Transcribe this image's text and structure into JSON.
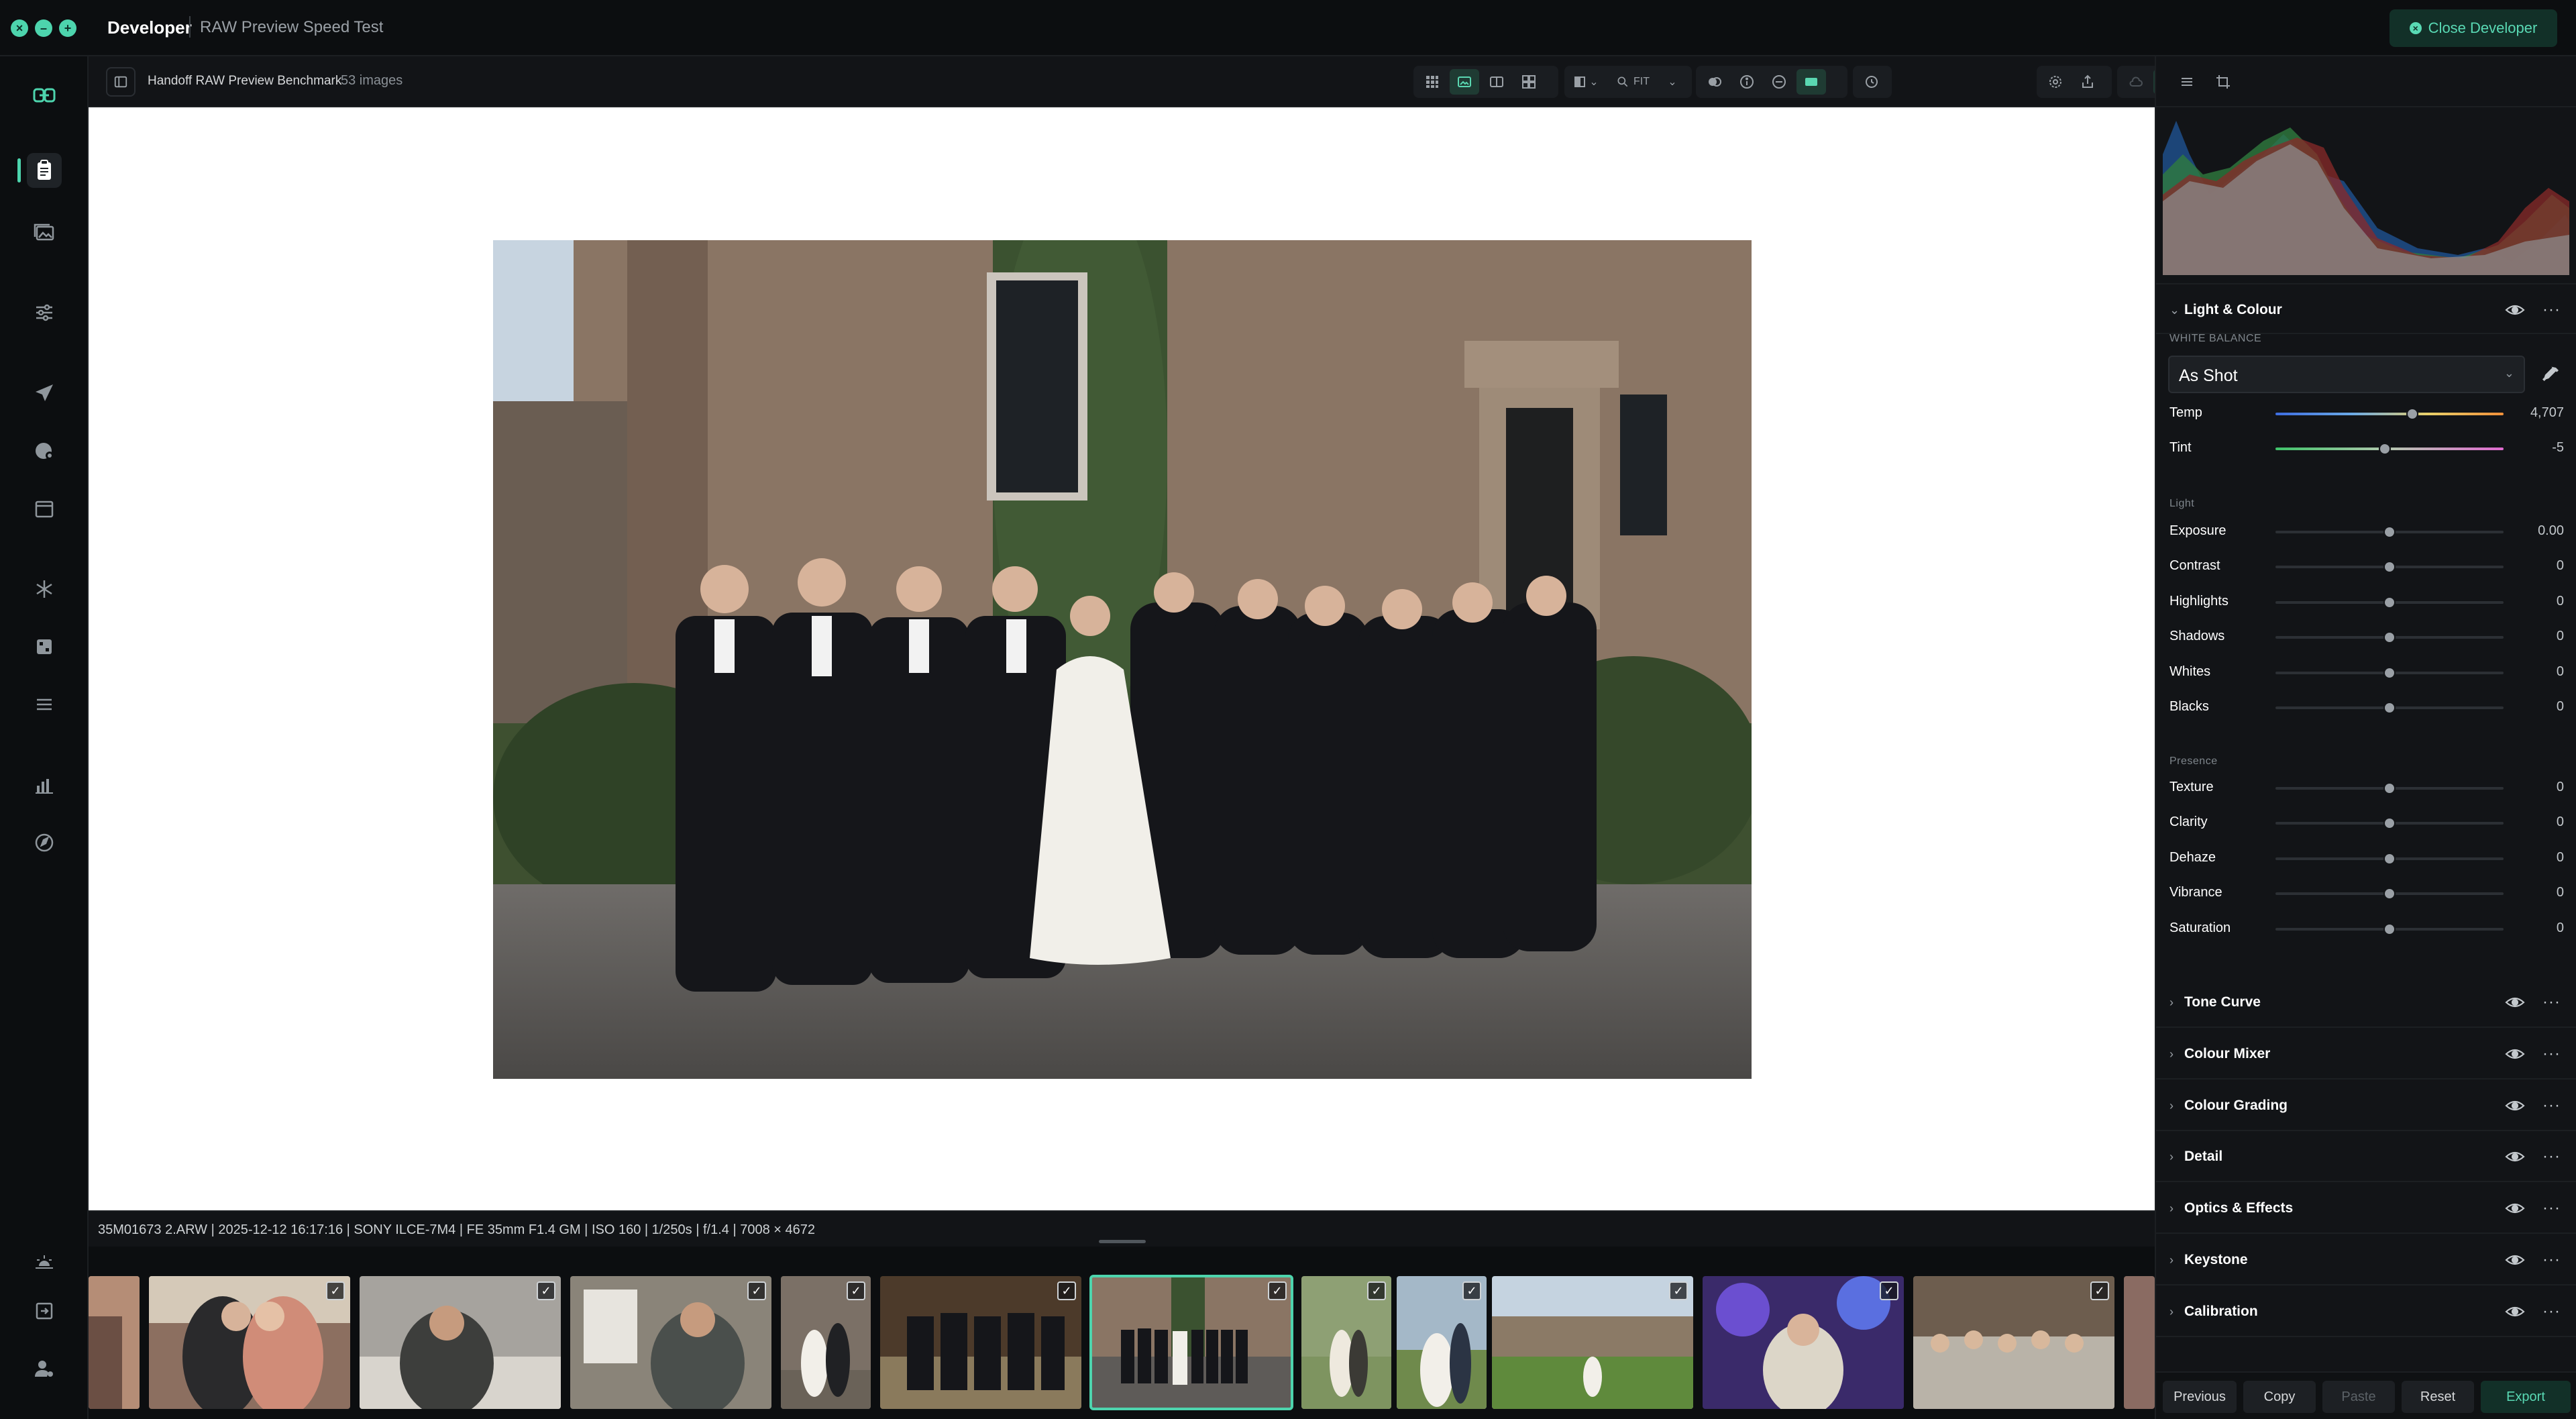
{
  "titlebar": {
    "title": "Developer",
    "subtitle": "RAW Preview Speed Test",
    "close_label": "Close Developer"
  },
  "leftnav": {
    "icons": [
      "link-logo-icon",
      "clipboard-icon",
      "photos-icon",
      "sliders-icon",
      "send-icon",
      "palette-icon",
      "calendar-icon",
      "snowflake-icon",
      "grid-icon",
      "list-icon",
      "bar-chart-icon",
      "compass-icon",
      "sunrise-icon",
      "export-icon",
      "user-settings-icon"
    ]
  },
  "toolbar": {
    "collection_name": "Handoff RAW Preview Benchmark",
    "image_count": "53 images",
    "zoom_label": "FIT"
  },
  "info": {
    "exif": "35M01673 2.ARW | 2025-12-12 16:17:16 | SONY ILCE-7M4 | FE 35mm F1.4 GM | ISO 160 | 1/250s | f/1.4 | 7008 × 4672"
  },
  "filmstrip": {
    "selected_index": 5,
    "thumbs": [
      {
        "checked": false
      },
      {
        "checked": true
      },
      {
        "checked": true
      },
      {
        "checked": true
      },
      {
        "checked": true
      },
      {
        "checked": true
      },
      {
        "checked": true
      },
      {
        "checked": true
      },
      {
        "checked": true
      },
      {
        "checked": true
      },
      {
        "checked": true
      },
      {
        "checked": true
      },
      {
        "checked": false
      }
    ]
  },
  "panel": {
    "light_colour": {
      "title": "Light & Colour",
      "white_balance_label": "WHITE BALANCE",
      "wb_value": "As Shot",
      "temp": {
        "label": "Temp",
        "value": "4,707",
        "pos": 0.6
      },
      "tint": {
        "label": "Tint",
        "value": "-5",
        "pos": 0.48
      },
      "light_label": "Light",
      "light": [
        {
          "label": "Exposure",
          "value": "0.00",
          "pos": 0.5
        },
        {
          "label": "Contrast",
          "value": "0",
          "pos": 0.5
        },
        {
          "label": "Highlights",
          "value": "0",
          "pos": 0.5
        },
        {
          "label": "Shadows",
          "value": "0",
          "pos": 0.5
        },
        {
          "label": "Whites",
          "value": "0",
          "pos": 0.5
        },
        {
          "label": "Blacks",
          "value": "0",
          "pos": 0.5
        }
      ],
      "presence_label": "Presence",
      "presence": [
        {
          "label": "Texture",
          "value": "0",
          "pos": 0.5
        },
        {
          "label": "Clarity",
          "value": "0",
          "pos": 0.5
        },
        {
          "label": "Dehaze",
          "value": "0",
          "pos": 0.5
        },
        {
          "label": "Vibrance",
          "value": "0",
          "pos": 0.5
        },
        {
          "label": "Saturation",
          "value": "0",
          "pos": 0.5
        }
      ]
    },
    "sections": [
      "Tone Curve",
      "Colour Mixer",
      "Colour Grading",
      "Detail",
      "Optics & Effects",
      "Keystone",
      "Calibration"
    ]
  },
  "footer": {
    "previous": "Previous",
    "copy": "Copy",
    "paste": "Paste",
    "reset": "Reset",
    "export": "Export"
  },
  "colors": {
    "accent": "#4dd4ad",
    "accent_dark": "#123028",
    "panel_bg": "#121417"
  }
}
